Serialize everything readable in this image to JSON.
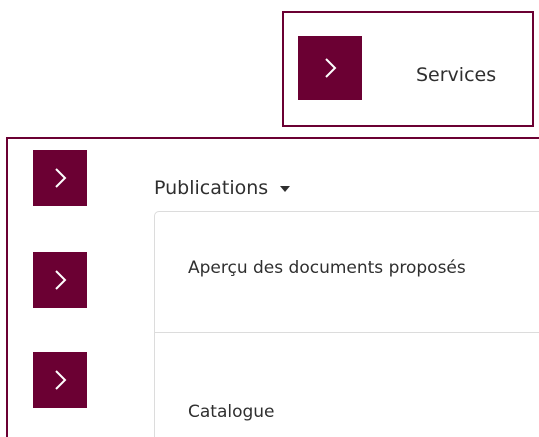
{
  "services_panel": {
    "label": "Services",
    "chevron_icon": "chevron-right-icon"
  },
  "publications_panel": {
    "header_label": "Publications",
    "header_caret_icon": "caret-down-icon",
    "chevron_icons": [
      "chevron-right-icon",
      "chevron-right-icon",
      "chevron-right-icon"
    ],
    "menu_items": [
      {
        "label": "Aperçu des documents proposés"
      },
      {
        "label": "Catalogue"
      }
    ]
  },
  "colors": {
    "accent": "#6b0033",
    "text": "#2f2f2f",
    "border": "#dcdcdc",
    "background": "#ffffff"
  }
}
